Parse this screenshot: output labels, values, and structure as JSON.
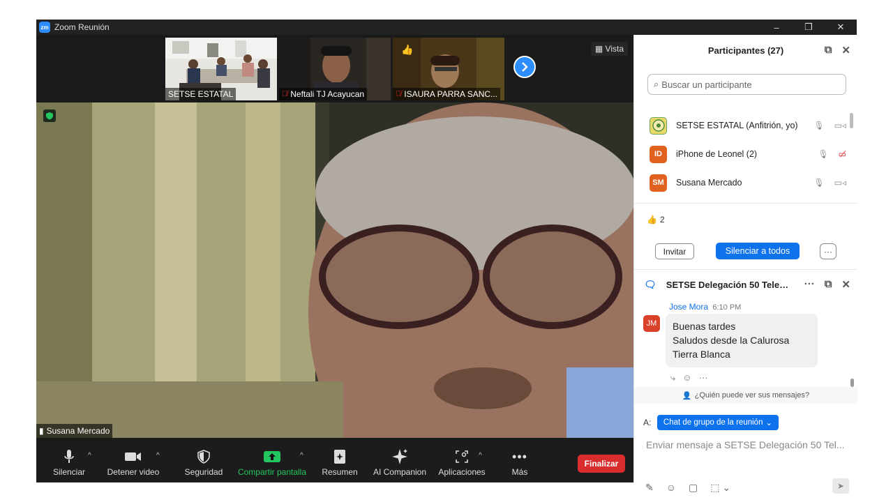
{
  "window": {
    "title": "Zoom Reunión",
    "logo_text": "zm",
    "minimize": "–",
    "restore": "❐",
    "close": "✕"
  },
  "thumbnails": [
    {
      "name": "SETSE ESTATAL",
      "muted": false
    },
    {
      "name": "Neftali TJ Acayucan",
      "muted": true
    },
    {
      "name": "ISAURA PARRA SANC...",
      "muted": true
    }
  ],
  "view_button": "Vista",
  "main_video": {
    "name": "Susana Mercado"
  },
  "toolbar": {
    "mute": "Silenciar",
    "video": "Detener video",
    "security": "Seguridad",
    "share": "Compartir pantalla",
    "summary": "Resumen",
    "ai": "AI Companion",
    "apps": "Aplicaciones",
    "more": "Más",
    "end": "Finalizar",
    "share_color": "#22c55e",
    "end_color": "#d92d2d"
  },
  "participants": {
    "title": "Participantes (27)",
    "search_placeholder": "Buscar un participante",
    "list": [
      {
        "initials": "",
        "name": "SETSE ESTATAL (Anfitrión, yo)",
        "color": "#c9b84a",
        "video_off": false
      },
      {
        "initials": "ID",
        "name": "iPhone de Leonel (2)",
        "color": "#e0621e",
        "video_off": true
      },
      {
        "initials": "SM",
        "name": "Susana Mercado",
        "color": "#e0621e",
        "video_off": false
      }
    ],
    "reaction_count": "2",
    "invite": "Invitar",
    "mute_all": "Silenciar a todos",
    "more": "···"
  },
  "chat": {
    "title": "SETSE Delegación 50 Teleb...",
    "message": {
      "sender": "Jose Mora",
      "initials": "JM",
      "time": "6:10 PM",
      "lines": [
        "Buenas tardes",
        "Saludos desde la Calurosa",
        "Tierra Blanca"
      ]
    },
    "who_can_see": "¿Quién puede ver sus mensajes?",
    "to_label": "A:",
    "to_value": "Chat de grupo de la reunión",
    "input_placeholder": "Enviar mensaje a SETSE Delegación 50 Tel..."
  }
}
